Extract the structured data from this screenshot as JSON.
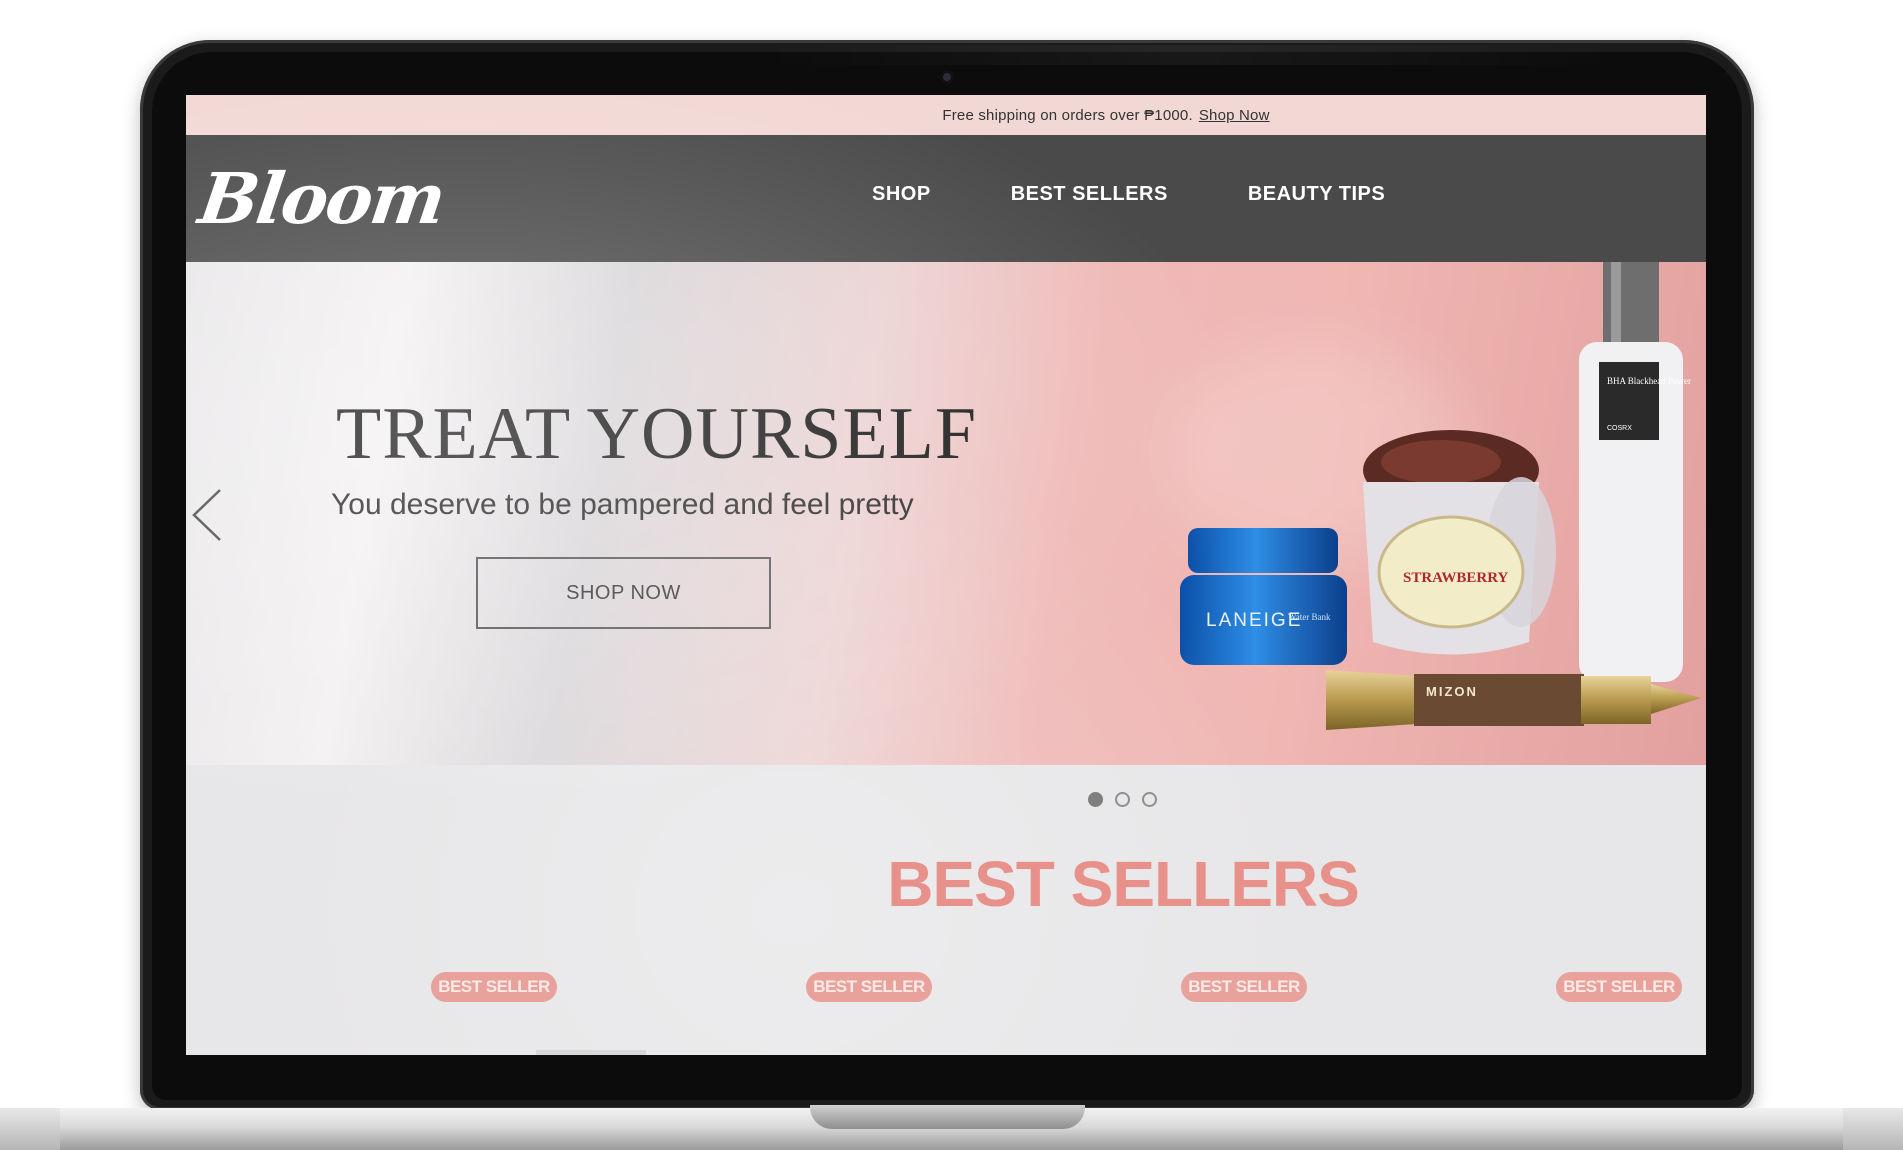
{
  "announcement": {
    "text": "Free shipping on orders over ₱1000.",
    "link_label": "Shop Now"
  },
  "brand": {
    "logo_text": "Bloom"
  },
  "nav": {
    "items": [
      {
        "label": "SHOP"
      },
      {
        "label": "BEST SELLERS"
      },
      {
        "label": "BEAUTY TIPS"
      }
    ]
  },
  "hero": {
    "title": "TREAT YOURSELF",
    "subtitle": "You deserve to be pampered and feel pretty",
    "cta_label": "SHOP NOW",
    "slides_total": 3,
    "active_slide": 1,
    "products": {
      "blue_jar_label": "LANEIGE",
      "blue_jar_sub": "Water Bank",
      "white_jar_label": "STRAWBERRY",
      "bottle_label": "BHA Blackhead Power Liquid",
      "bottle_brand": "COSRX",
      "tube_label": "MIZON"
    }
  },
  "best_sellers": {
    "title": "BEST SELLERS",
    "badge_label": "BEST SELLER",
    "badges": [
      "BEST SELLER",
      "BEST SELLER",
      "BEST SELLER",
      "BEST SELLER"
    ]
  },
  "colors": {
    "announcement_bg": "#f2d8d4",
    "navbar_bg": "#4a4a4a",
    "accent": "#e8918a",
    "badge_bg": "#e8a29b"
  }
}
